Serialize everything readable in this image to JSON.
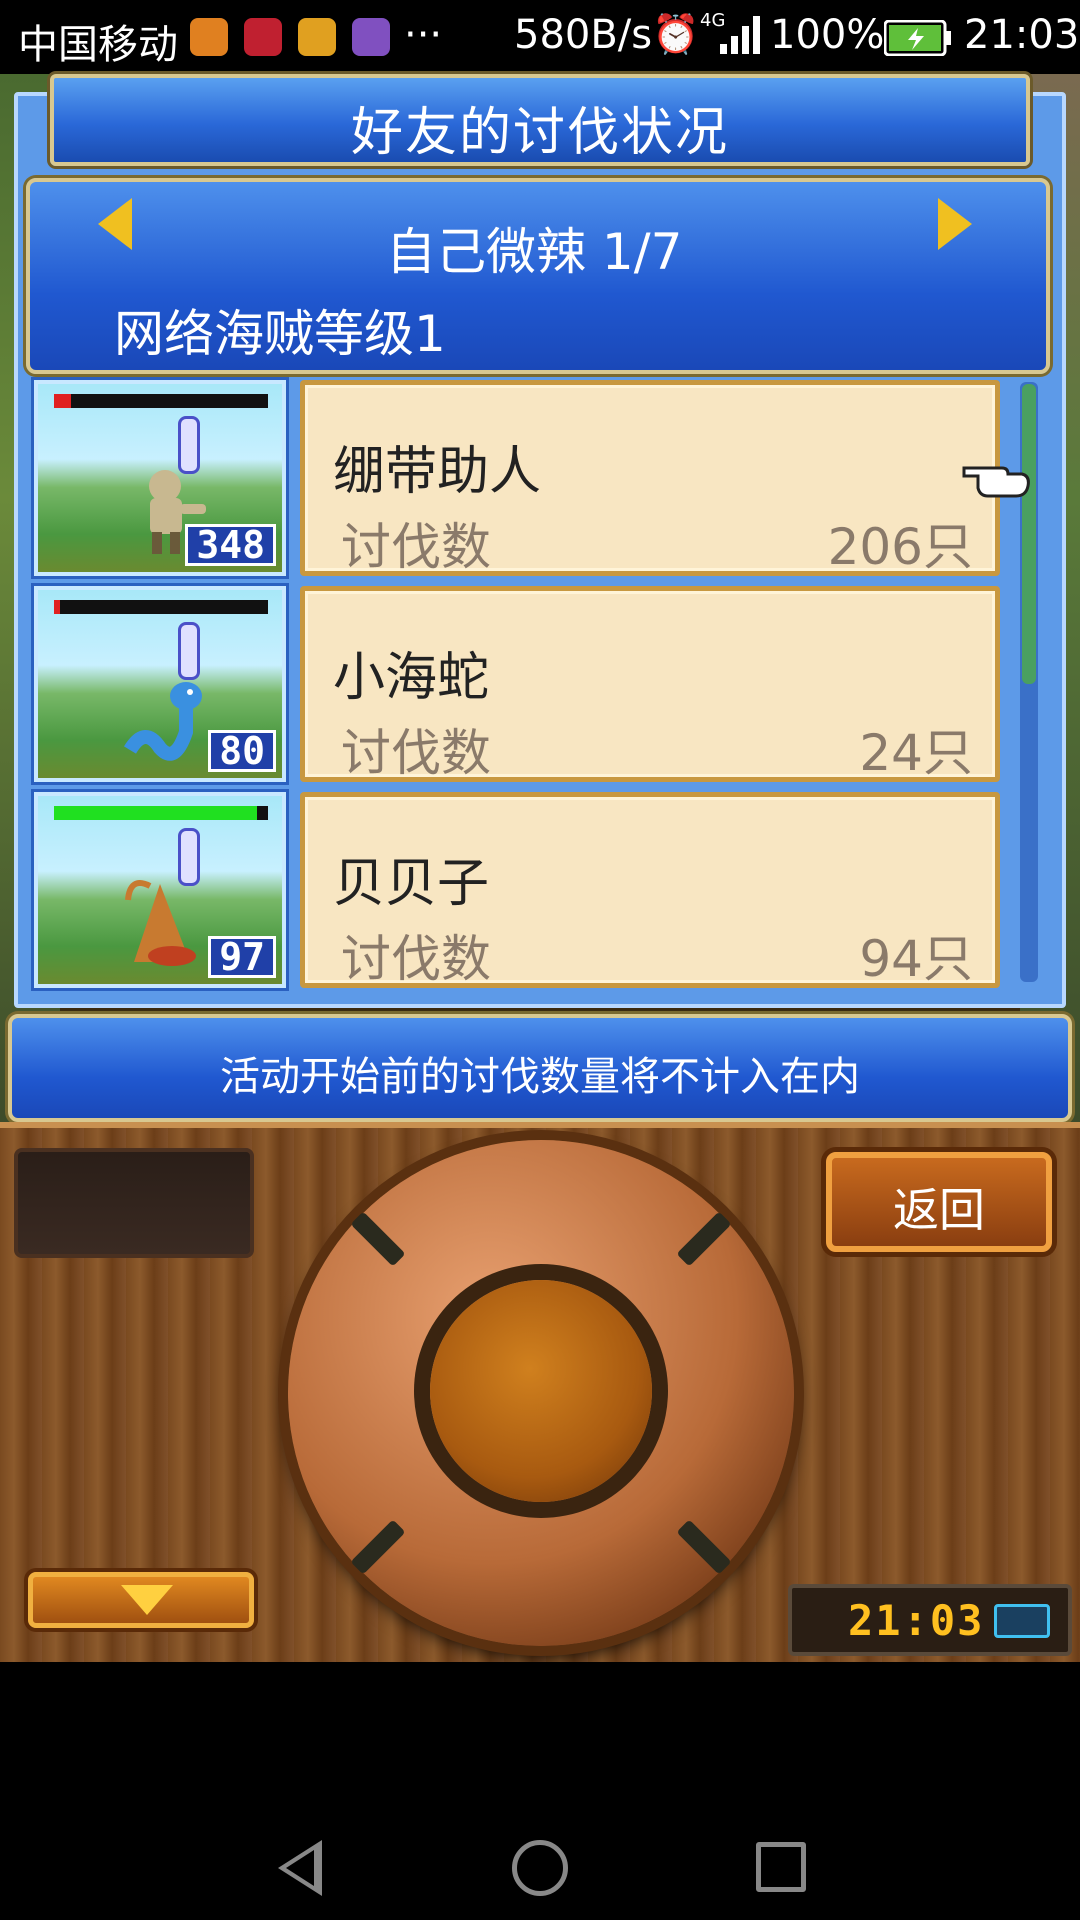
{
  "status_bar": {
    "carrier": "中国移动",
    "more": "···",
    "network_speed": "580B/s",
    "signal": "4G",
    "battery": "100%",
    "time": "21:03"
  },
  "title": "好友的讨伐状况",
  "friend": {
    "name": "自己微辣",
    "page": "1/7",
    "level": "网络海贼等级1"
  },
  "monsters": [
    {
      "name": "绷带助人",
      "count_label": "讨伐数",
      "count": "206只",
      "level": "348",
      "hp": 0.08,
      "hp_color": "#e02020",
      "body_color": "#c8b890"
    },
    {
      "name": "小海蛇",
      "count_label": "讨伐数",
      "count": "24只",
      "level": "80",
      "hp": 0.03,
      "hp_color": "#e02020",
      "body_color": "#3a90e0"
    },
    {
      "name": "贝贝子",
      "count_label": "讨伐数",
      "count": "94只",
      "level": "97",
      "hp": 0.95,
      "hp_color": "#20e020",
      "body_color": "#c87a30"
    }
  ],
  "notice": "活动开始前的讨伐数量将不计入在内",
  "controls": {
    "back_label": "返回",
    "clock": "21:03"
  },
  "colors": {
    "panel_blue": "#2058d0",
    "card_bg": "#f8e6c2",
    "wood": "#7a4a20"
  }
}
